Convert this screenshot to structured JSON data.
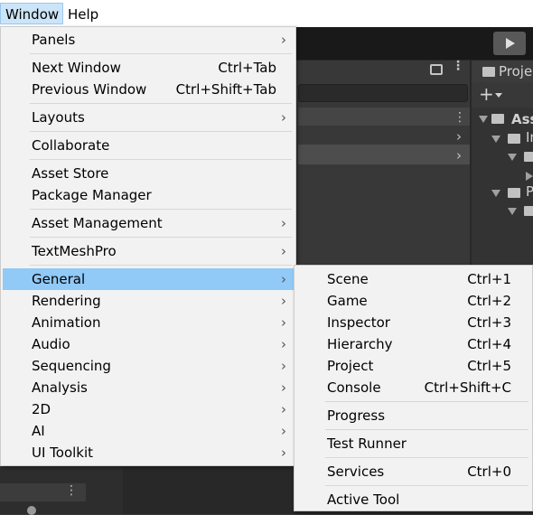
{
  "menubar": {
    "window_label": "Window",
    "help_label": "Help"
  },
  "editor": {
    "project_tab_label": "Proje",
    "add_symbol": "+",
    "tree": [
      "Ass",
      "In",
      "P"
    ]
  },
  "window_menu": {
    "panels": "Panels",
    "next_window": "Next Window",
    "next_window_sc": "Ctrl+Tab",
    "previous_window": "Previous Window",
    "previous_window_sc": "Ctrl+Shift+Tab",
    "layouts": "Layouts",
    "collaborate": "Collaborate",
    "asset_store": "Asset Store",
    "package_manager": "Package Manager",
    "asset_management": "Asset Management",
    "textmeshpro": "TextMeshPro",
    "general": "General",
    "rendering": "Rendering",
    "animation": "Animation",
    "audio": "Audio",
    "sequencing": "Sequencing",
    "analysis": "Analysis",
    "twod": "2D",
    "ai": "AI",
    "ui_toolkit": "UI Toolkit"
  },
  "general_submenu": {
    "scene": "Scene",
    "scene_sc": "Ctrl+1",
    "game": "Game",
    "game_sc": "Ctrl+2",
    "inspector": "Inspector",
    "inspector_sc": "Ctrl+3",
    "hierarchy": "Hierarchy",
    "hierarchy_sc": "Ctrl+4",
    "project": "Project",
    "project_sc": "Ctrl+5",
    "console": "Console",
    "console_sc": "Ctrl+Shift+C",
    "progress": "Progress",
    "test_runner": "Test Runner",
    "services": "Services",
    "services_sc": "Ctrl+0",
    "active_tool": "Active Tool"
  }
}
